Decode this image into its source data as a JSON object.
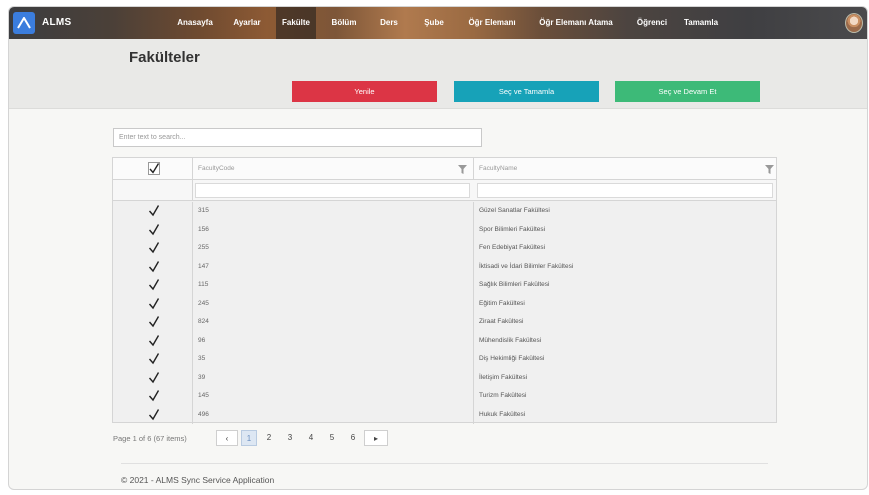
{
  "app": {
    "brand": "ALMS"
  },
  "nav": [
    {
      "label": "Anasayfa",
      "active": false
    },
    {
      "label": "Ayarlar",
      "active": false
    },
    {
      "label": "Fakülte",
      "active": true
    },
    {
      "label": "Bölüm",
      "active": false
    },
    {
      "label": "Ders",
      "active": false
    },
    {
      "label": "Şube",
      "active": false
    },
    {
      "label": "Öğr Elemanı",
      "active": false
    },
    {
      "label": "Öğr Elemanı Atama",
      "active": false
    },
    {
      "label": "Öğrenci",
      "active": false
    },
    {
      "label": "Tamamla",
      "active": false
    }
  ],
  "page": {
    "title": "Fakülteler"
  },
  "actions": {
    "refresh": "Yenile",
    "select_complete": "Seç ve Tamamla",
    "select_continue": "Seç ve Devam Et"
  },
  "search": {
    "placeholder": "Enter text to search..."
  },
  "grid": {
    "columns": [
      "FacultyCode",
      "FacultyName"
    ],
    "rows": [
      {
        "code": "315",
        "name": "Güzel Sanatlar Fakültesi",
        "checked": true
      },
      {
        "code": "156",
        "name": "Spor Bilimleri Fakültesi",
        "checked": true
      },
      {
        "code": "255",
        "name": "Fen Edebiyat Fakültesi",
        "checked": true
      },
      {
        "code": "147",
        "name": "İktisadi ve İdari Bilimler Fakültesi",
        "checked": true
      },
      {
        "code": "115",
        "name": "Sağlık Bilimleri Fakültesi",
        "checked": true
      },
      {
        "code": "245",
        "name": "Eğitim Fakültesi",
        "checked": true
      },
      {
        "code": "824",
        "name": "Ziraat Fakültesi",
        "checked": true
      },
      {
        "code": "96",
        "name": "Mühendislik Fakültesi",
        "checked": true
      },
      {
        "code": "35",
        "name": "Diş Hekimliği Fakültesi",
        "checked": true
      },
      {
        "code": "39",
        "name": "İletişim Fakültesi",
        "checked": true
      },
      {
        "code": "145",
        "name": "Turizm Fakültesi",
        "checked": true
      },
      {
        "code": "496",
        "name": "Hukuk Fakültesi",
        "checked": true
      }
    ]
  },
  "pager": {
    "info": "Page 1 of 6 (67 items)",
    "prev": "‹",
    "pages": [
      "1",
      "2",
      "3",
      "4",
      "5",
      "6"
    ],
    "next": "▸"
  },
  "footer": {
    "text": "© 2021 - ALMS Sync Service Application"
  }
}
